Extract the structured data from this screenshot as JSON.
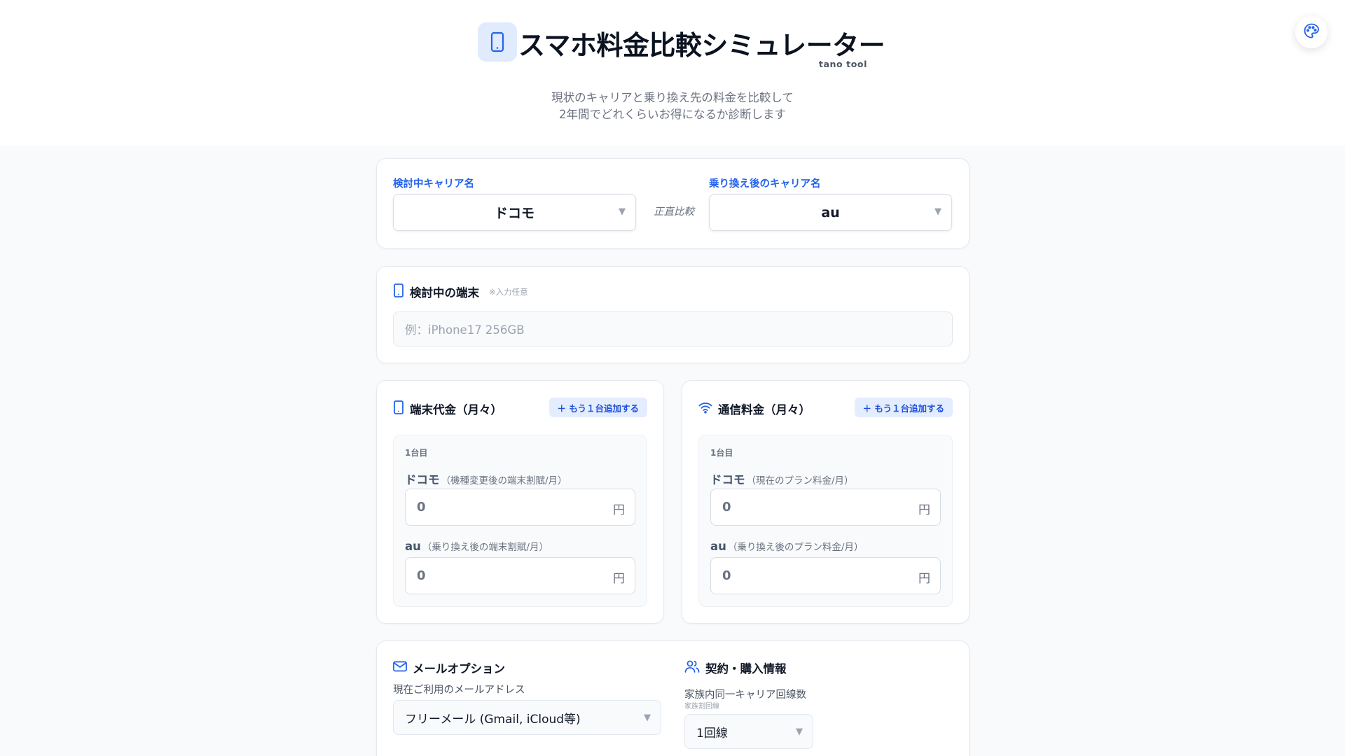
{
  "header": {
    "title": "スマホ料金比較シミュレーター",
    "brand": "tano tool",
    "subtitle_line1": "現状のキャリアと乗り換え先の料金を比較して",
    "subtitle_line2": "2年間でどれくらいお得になるか診断します"
  },
  "icons": {
    "title_icon": "smartphone-icon",
    "theme_button": "palette-icon"
  },
  "colors": {
    "accent": "#2563eb",
    "accent_soft": "#e3edfd",
    "page_bg": "#f8fafc"
  },
  "carriers": {
    "current_label": "検討中キャリア名",
    "current_value": "ドコモ",
    "compare_label": "正直比較",
    "target_label": "乗り換え後のキャリア名",
    "target_value": "au"
  },
  "device": {
    "title": "検討中の端末",
    "hint": "※入力任意",
    "placeholder": "例：iPhone17 256GB"
  },
  "device_cost": {
    "title": "端末代金（月々）",
    "add_label": "＋ もう１台追加する",
    "unit_label": "1台目",
    "current_name": "ドコモ",
    "current_desc": "（機種変更後の端末割賦/月）",
    "current_value": "0",
    "target_name": "au",
    "target_desc": "（乗り換え後の端末割賦/月）",
    "target_value": "0",
    "currency": "円"
  },
  "plan_cost": {
    "title": "通信料金（月々）",
    "add_label": "＋ もう１台追加する",
    "unit_label": "1台目",
    "current_name": "ドコモ",
    "current_desc": "（現在のプラン料金/月）",
    "current_value": "0",
    "target_name": "au",
    "target_desc": "（乗り換え後のプラン料金/月）",
    "target_value": "0",
    "currency": "円"
  },
  "mail": {
    "title": "メールオプション",
    "field_label": "現在ご利用のメールアドレス",
    "selected": "フリーメール (Gmail, iCloud等)"
  },
  "contract": {
    "title": "契約・購入情報",
    "field_label": "家族内同一キャリア回線数",
    "field_sub": "家族割回線",
    "selected": "1回線"
  }
}
